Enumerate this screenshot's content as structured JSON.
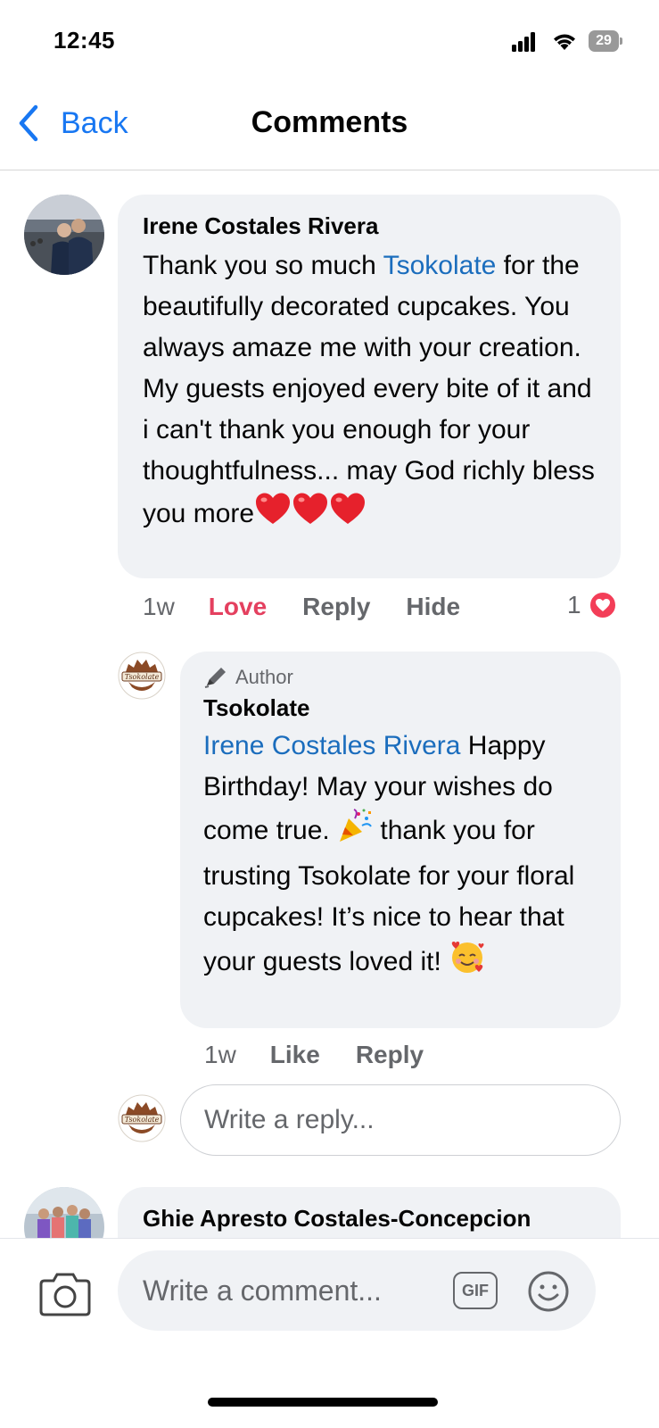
{
  "status_bar": {
    "time": "12:45",
    "battery": "29",
    "icons": [
      "signal-icon",
      "wifi-icon",
      "battery-icon"
    ]
  },
  "nav": {
    "back_label": "Back",
    "title": "Comments"
  },
  "comments": [
    {
      "author": "Irene Costales Rivera",
      "text_before_mention": "Thank you so much ",
      "mention": "Tsokolate",
      "text_after_mention": " for the beautifully decorated cupcakes. You always amaze me with your creation. My guests enjoyed every bite of it and i can't thank you enough for your thoughtfulness... may God richly bless you more",
      "trailing_emojis": [
        "heart-emoji",
        "heart-emoji",
        "heart-emoji"
      ],
      "time": "1w",
      "love_label": "Love",
      "reply_label": "Reply",
      "hide_label": "Hide",
      "reaction_count": "1",
      "reaction_type": "love"
    }
  ],
  "reply": {
    "author_badge": "Author",
    "author": "Tsokolate",
    "mention": "Irene Costales Rivera",
    "text_part1": " Happy Birthday! May your wishes do come true. ",
    "text_part2": " thank you for trusting Tsokolate for your floral cupcakes! It’s nice to hear that your guests loved it! ",
    "emojis": [
      "party-popper-emoji",
      "smiling-face-hearts-emoji"
    ],
    "time": "1w",
    "like_label": "Like",
    "reply_label": "Reply",
    "avatar_text": "Tsokolate"
  },
  "reply_input": {
    "placeholder": "Write a reply...",
    "avatar_text": "Tsokolate"
  },
  "next_comment": {
    "author": "Ghie Apresto Costales-Concepcion"
  },
  "composer": {
    "placeholder": "Write a comment...",
    "gif_label": "GIF"
  },
  "colors": {
    "link": "#1b6dbd",
    "ios_blue": "#1877f2",
    "love": "#e4405f",
    "bubble": "#f0f2f5",
    "secondary_text": "#65676b"
  }
}
